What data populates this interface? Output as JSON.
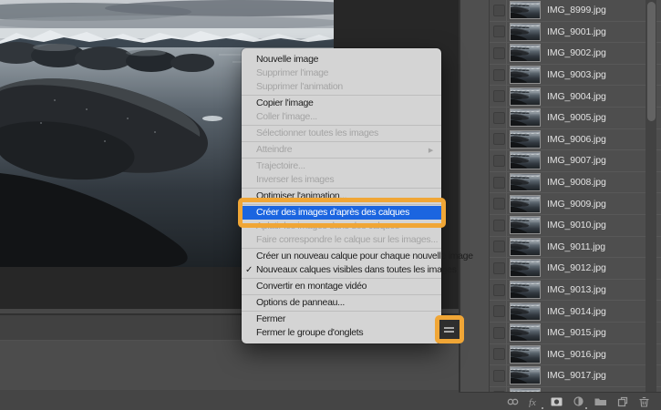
{
  "colors": {
    "annotation_orange": "#f0a636",
    "selection_blue": "#1b65e0",
    "menu_background": "#d4d4d4",
    "panel_background": "#4e4e4e"
  },
  "context_menu": {
    "check_glyph": "✓",
    "submenu_glyph": "▶",
    "items": [
      {
        "label": "Nouvelle image",
        "state": "enabled"
      },
      {
        "label": "Supprimer l'image",
        "state": "disabled"
      },
      {
        "label": "Supprimer l'animation",
        "state": "disabled"
      },
      {
        "type": "separator"
      },
      {
        "label": "Copier l'image",
        "state": "enabled"
      },
      {
        "label": "Coller l'image...",
        "state": "disabled"
      },
      {
        "type": "separator"
      },
      {
        "label": "Sélectionner toutes les images",
        "state": "disabled"
      },
      {
        "type": "separator"
      },
      {
        "label": "Atteindre",
        "state": "disabled",
        "submenu": true
      },
      {
        "type": "separator"
      },
      {
        "label": "Trajectoire...",
        "state": "disabled"
      },
      {
        "label": "Inverser les images",
        "state": "disabled"
      },
      {
        "type": "separator"
      },
      {
        "label": "Optimiser l'animation...",
        "state": "enabled"
      },
      {
        "type": "separator"
      },
      {
        "label": "Créer des images d'après des calques",
        "state": "selected"
      },
      {
        "label": "Aplatir les images dans des calques",
        "state": "disabled"
      },
      {
        "label": "Faire correspondre le calque sur les images...",
        "state": "disabled"
      },
      {
        "type": "separator"
      },
      {
        "label": "Créer un nouveau calque pour chaque nouvelle image",
        "state": "enabled"
      },
      {
        "label": "Nouveaux calques visibles dans toutes les images",
        "state": "enabled",
        "checked": true
      },
      {
        "type": "separator"
      },
      {
        "label": "Convertir en montage vidéo",
        "state": "enabled"
      },
      {
        "type": "separator"
      },
      {
        "label": "Options de panneau...",
        "state": "enabled"
      },
      {
        "type": "separator"
      },
      {
        "label": "Fermer",
        "state": "enabled"
      },
      {
        "label": "Fermer le groupe d'onglets",
        "state": "enabled"
      }
    ]
  },
  "frames_panel": {
    "files": [
      "IMG_8999.jpg",
      "IMG_9001.jpg",
      "IMG_9002.jpg",
      "IMG_9003.jpg",
      "IMG_9004.jpg",
      "IMG_9005.jpg",
      "IMG_9006.jpg",
      "IMG_9007.jpg",
      "IMG_9008.jpg",
      "IMG_9009.jpg",
      "IMG_9010.jpg",
      "IMG_9011.jpg",
      "IMG_9012.jpg",
      "IMG_9013.jpg",
      "IMG_9014.jpg",
      "IMG_9015.jpg",
      "IMG_9016.jpg",
      "IMG_9017.jpg"
    ],
    "has_partial_row": true,
    "toolbar_icons": [
      "link",
      "effects",
      "layer-mask",
      "adjustment",
      "folder",
      "new-layer",
      "delete"
    ]
  }
}
